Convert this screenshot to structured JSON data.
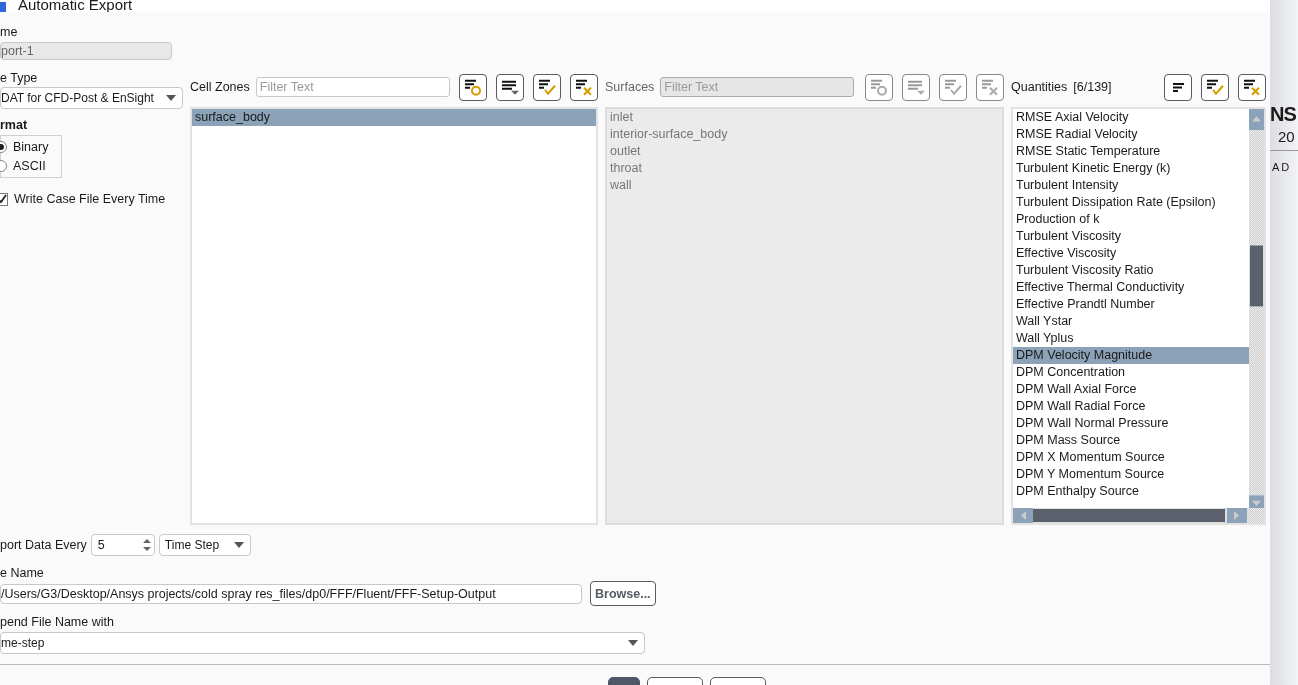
{
  "window": {
    "title": "Automatic Export"
  },
  "name": {
    "label": "me",
    "value": "port-1",
    "disabled": true
  },
  "file_type": {
    "label": "e Type",
    "value": "DAT for CFD-Post & EnSight"
  },
  "format": {
    "label": "rmat",
    "options": [
      {
        "label": "Binary",
        "selected": true
      },
      {
        "label": "ASCII",
        "selected": false
      }
    ]
  },
  "write_case_file": {
    "label": "Write Case File Every Time",
    "checked": true
  },
  "panels": [
    {
      "kind": "filtered",
      "title": "Cell Zones",
      "filter_placeholder": "Filter Text",
      "disabled": false,
      "items": [
        {
          "label": "surface_body",
          "selected": true
        }
      ]
    },
    {
      "kind": "filtered",
      "title": "Surfaces",
      "filter_placeholder": "Filter Text",
      "disabled": true,
      "items": [
        {
          "label": "inlet",
          "selected": false
        },
        {
          "label": "interior-surface_body",
          "selected": false
        },
        {
          "label": "outlet",
          "selected": false
        },
        {
          "label": "throat",
          "selected": false
        },
        {
          "label": "wall",
          "selected": false
        }
      ]
    },
    {
      "kind": "counted",
      "title": "Quantities",
      "count": "[6/139]",
      "disabled": false,
      "items": [
        {
          "label": "RMSE Axial Velocity",
          "selected": false
        },
        {
          "label": "RMSE Radial Velocity",
          "selected": false
        },
        {
          "label": "RMSE Static Temperature",
          "selected": false
        },
        {
          "label": "Turbulent Kinetic Energy (k)",
          "selected": false
        },
        {
          "label": "Turbulent Intensity",
          "selected": false
        },
        {
          "label": "Turbulent Dissipation Rate (Epsilon)",
          "selected": false
        },
        {
          "label": "Production of k",
          "selected": false
        },
        {
          "label": "Turbulent Viscosity",
          "selected": false
        },
        {
          "label": "Effective Viscosity",
          "selected": false
        },
        {
          "label": "Turbulent Viscosity Ratio",
          "selected": false
        },
        {
          "label": "Effective Thermal Conductivity",
          "selected": false
        },
        {
          "label": "Effective Prandtl Number",
          "selected": false
        },
        {
          "label": "Wall Ystar",
          "selected": false
        },
        {
          "label": "Wall Yplus",
          "selected": false
        },
        {
          "label": "DPM Velocity Magnitude",
          "selected": true
        },
        {
          "label": "DPM Concentration",
          "selected": false
        },
        {
          "label": "DPM Wall Axial Force",
          "selected": false
        },
        {
          "label": "DPM Wall Radial Force",
          "selected": false
        },
        {
          "label": "DPM Wall Normal Pressure",
          "selected": false
        },
        {
          "label": "DPM Mass Source",
          "selected": false
        },
        {
          "label": "DPM X Momentum Source",
          "selected": false
        },
        {
          "label": "DPM Y Momentum Source",
          "selected": false
        },
        {
          "label": "DPM Enthalpy Source",
          "selected": false
        }
      ]
    }
  ],
  "export_every": {
    "label": "port Data Every",
    "value": "5",
    "unit": "Time Step"
  },
  "file_name": {
    "label": "e Name",
    "value": "/Users/G3/Desktop/Ansys projects/cold spray res_files/dp0/FFF/Fluent/FFF-Setup-Output",
    "browse": "Browse..."
  },
  "append": {
    "label": "pend File Name with",
    "value": "me-step"
  },
  "buttons": [
    {
      "default": true
    },
    {
      "default": false
    },
    {
      "default": false
    }
  ],
  "background_app": {
    "texts": [
      "NS",
      "20",
      "AD"
    ]
  }
}
